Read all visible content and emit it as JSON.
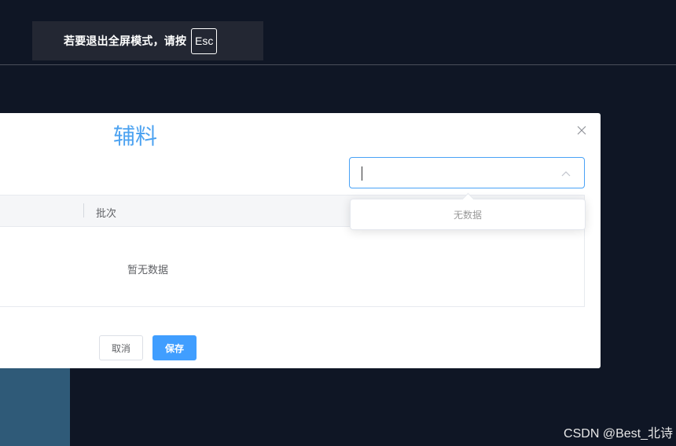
{
  "fullscreen_notice": {
    "text": "若要退出全屏模式，请按",
    "key": "Esc"
  },
  "dialog": {
    "title": "辅料",
    "select": {
      "value": "",
      "dropdown_empty_text": "无数据"
    },
    "table": {
      "columns": [
        "批次"
      ],
      "empty_text": "暂无数据"
    },
    "buttons": {
      "cancel": "取消",
      "save": "保存"
    }
  },
  "watermark": "CSDN @Best_北诗",
  "colors": {
    "accent": "#409eff",
    "title": "#4da3f1",
    "background": "#0f1625"
  }
}
